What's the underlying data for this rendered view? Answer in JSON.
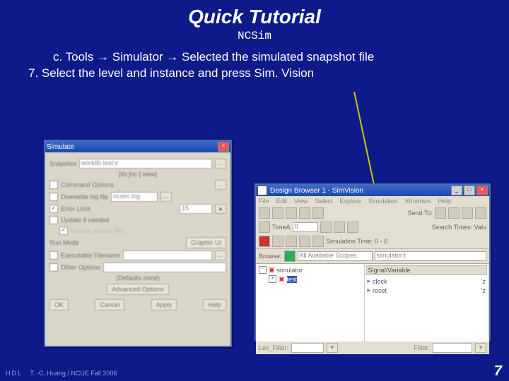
{
  "title": "Quick Tutorial",
  "subtitle": "NCSim",
  "step_c": "c.   Tools → Simulator → Selected the simulated snapshot file",
  "step_7": "7.   Select the level and instance and press Sim. Vision",
  "footer_hdl": "HDL",
  "footer_text": "T. -C. Huang / NCUE  Fall 2006",
  "page_num": "7",
  "win1": {
    "title": "Simulate",
    "snapshot_lbl": "Snapshot",
    "snapshot_val": "worklib.test:v",
    "hint": "[lib.]nc [:view]",
    "cmd_opt": "Command Options",
    "overwrite": "Overwrite log file",
    "logval": "ncsim.log",
    "errlimit": "Error Limit",
    "errval": "15",
    "upd_inc": "Update if needed",
    "upd_src": "Update source files",
    "runmode": "Run Mode",
    "gui": "Graphic UI",
    "exec": "Executable Filename",
    "other": "Other Options",
    "defaults": "(Defaults none)",
    "adv": "Advanced Options",
    "ok": "OK",
    "cancel": "Cancel",
    "apply": "Apply",
    "help": "Help"
  },
  "win2": {
    "title": "Design Browser 1 - SimVision",
    "menus": [
      "File",
      "Edit",
      "View",
      "Select",
      "Explore",
      "Simulation",
      "Windows",
      "Help"
    ],
    "sendto": "Send To:",
    "time_lbl": "TimeA",
    "time_val": "0",
    "search": "Search Times: Valu",
    "simtime": "Simulation Time: 0 - 0",
    "browse": "Browse:",
    "scopes": "All Available Scopes",
    "tree_root": "simulator",
    "tree_sel": "test",
    "right_hdr": "Signal/Variable",
    "sig1": "clock",
    "sig2": "reset",
    "levfilter": "Lev_Filter:",
    "filter": "Filter:"
  }
}
